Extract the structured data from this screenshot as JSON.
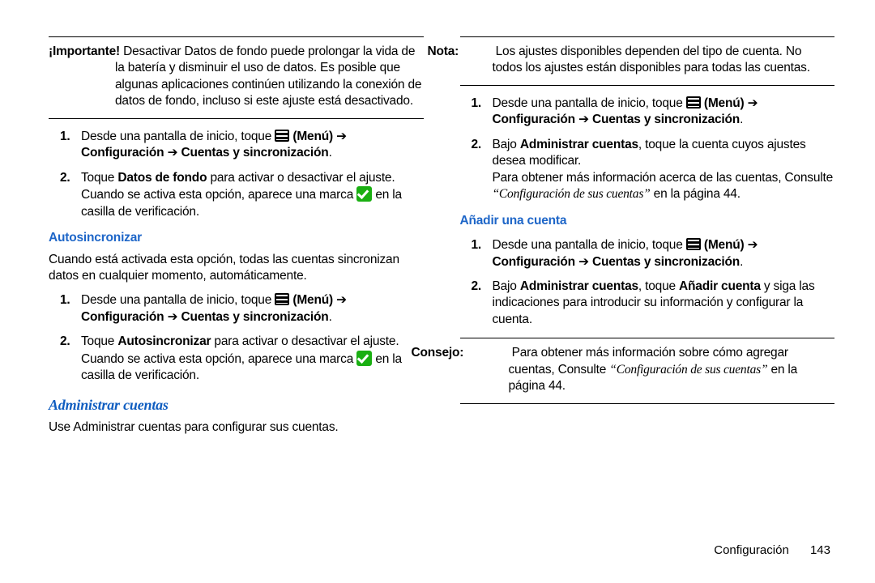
{
  "col1": {
    "important": {
      "label": "¡Importante!",
      "text": "Desactivar Datos de fondo puede prolongar la vida de la batería y disminuir el uso de datos. Es posible que algunas aplicaciones continúen utilizando la conexión de datos de fondo, incluso si este ajuste está desactivado."
    },
    "steps_a": {
      "1": {
        "pre": "Desde una pantalla de inicio, toque ",
        "menu": "(Menú)",
        "arrow": " ➔ ",
        "conf": "Configuración",
        "arrow2": " ➔ ",
        "acc": "Cuentas y sincronización",
        "dot": "."
      },
      "2": {
        "pre": "Toque ",
        "bold": "Datos de fondo",
        "mid": " para activar o desactivar el ajuste. Cuando se activa esta opción, aparece una marca ",
        "end": " en la casilla de verificación."
      }
    },
    "autosync": {
      "heading": "Autosincronizar",
      "para": "Cuando está activada esta opción, todas las cuentas sincronizan datos en cualquier momento, automáticamente."
    },
    "steps_b": {
      "1": {
        "pre": "Desde una pantalla de inicio, toque ",
        "menu": "(Menú)",
        "arrow": " ➔ ",
        "conf": "Configuración",
        "arrow2": " ➔ ",
        "acc": "Cuentas y sincronización",
        "dot": "."
      },
      "2": {
        "pre": "Toque ",
        "bold": "Autosincronizar",
        "mid": " para activar o desactivar el ajuste. Cuando se activa esta opción, aparece una marca ",
        "end": " en la casilla de verificación."
      }
    },
    "manage": {
      "heading": "Administrar cuentas",
      "para": "Use Administrar cuentas para configurar sus cuentas."
    }
  },
  "col2": {
    "nota": {
      "label": "Nota:",
      "text": "Los ajustes disponibles dependen del tipo de cuenta. No todos los ajustes están disponibles para todas las cuentas."
    },
    "steps_c": {
      "1": {
        "pre": "Desde una pantalla de inicio, toque ",
        "menu": "(Menú)",
        "arrow": " ➔ ",
        "conf": "Configuración",
        "arrow2": " ➔ ",
        "acc": "Cuentas y sincronización",
        "dot": "."
      },
      "2": {
        "pre": "Bajo ",
        "bold": "Administrar cuentas",
        "mid": ", toque la cuenta cuyos ajustes desea modificar.",
        "extra1": "Para obtener más información acerca de las cuentas, Consulte ",
        "ref": "“Configuración de sus cuentas”",
        "extra2": " en la página 44."
      }
    },
    "add": {
      "heading": "Añadir una cuenta"
    },
    "steps_d": {
      "1": {
        "pre": "Desde una pantalla de inicio, toque ",
        "menu": "(Menú)",
        "arrow": " ➔ ",
        "conf": "Configuración",
        "arrow2": " ➔ ",
        "acc": "Cuentas y sincronización",
        "dot": "."
      },
      "2": {
        "pre": "Bajo ",
        "bold1": "Administrar cuentas",
        "mid": ", toque ",
        "bold2": "Añadir cuenta",
        "end": " y siga las indicaciones para introducir su información y configurar la cuenta."
      }
    },
    "consejo": {
      "label": "Consejo:",
      "pre": "Para obtener más información sobre cómo agregar cuentas, Consulte ",
      "ref": "“Configuración de sus cuentas”",
      "post": " en la página 44."
    }
  },
  "footer": {
    "chapter": "Configuración",
    "page": "143"
  }
}
